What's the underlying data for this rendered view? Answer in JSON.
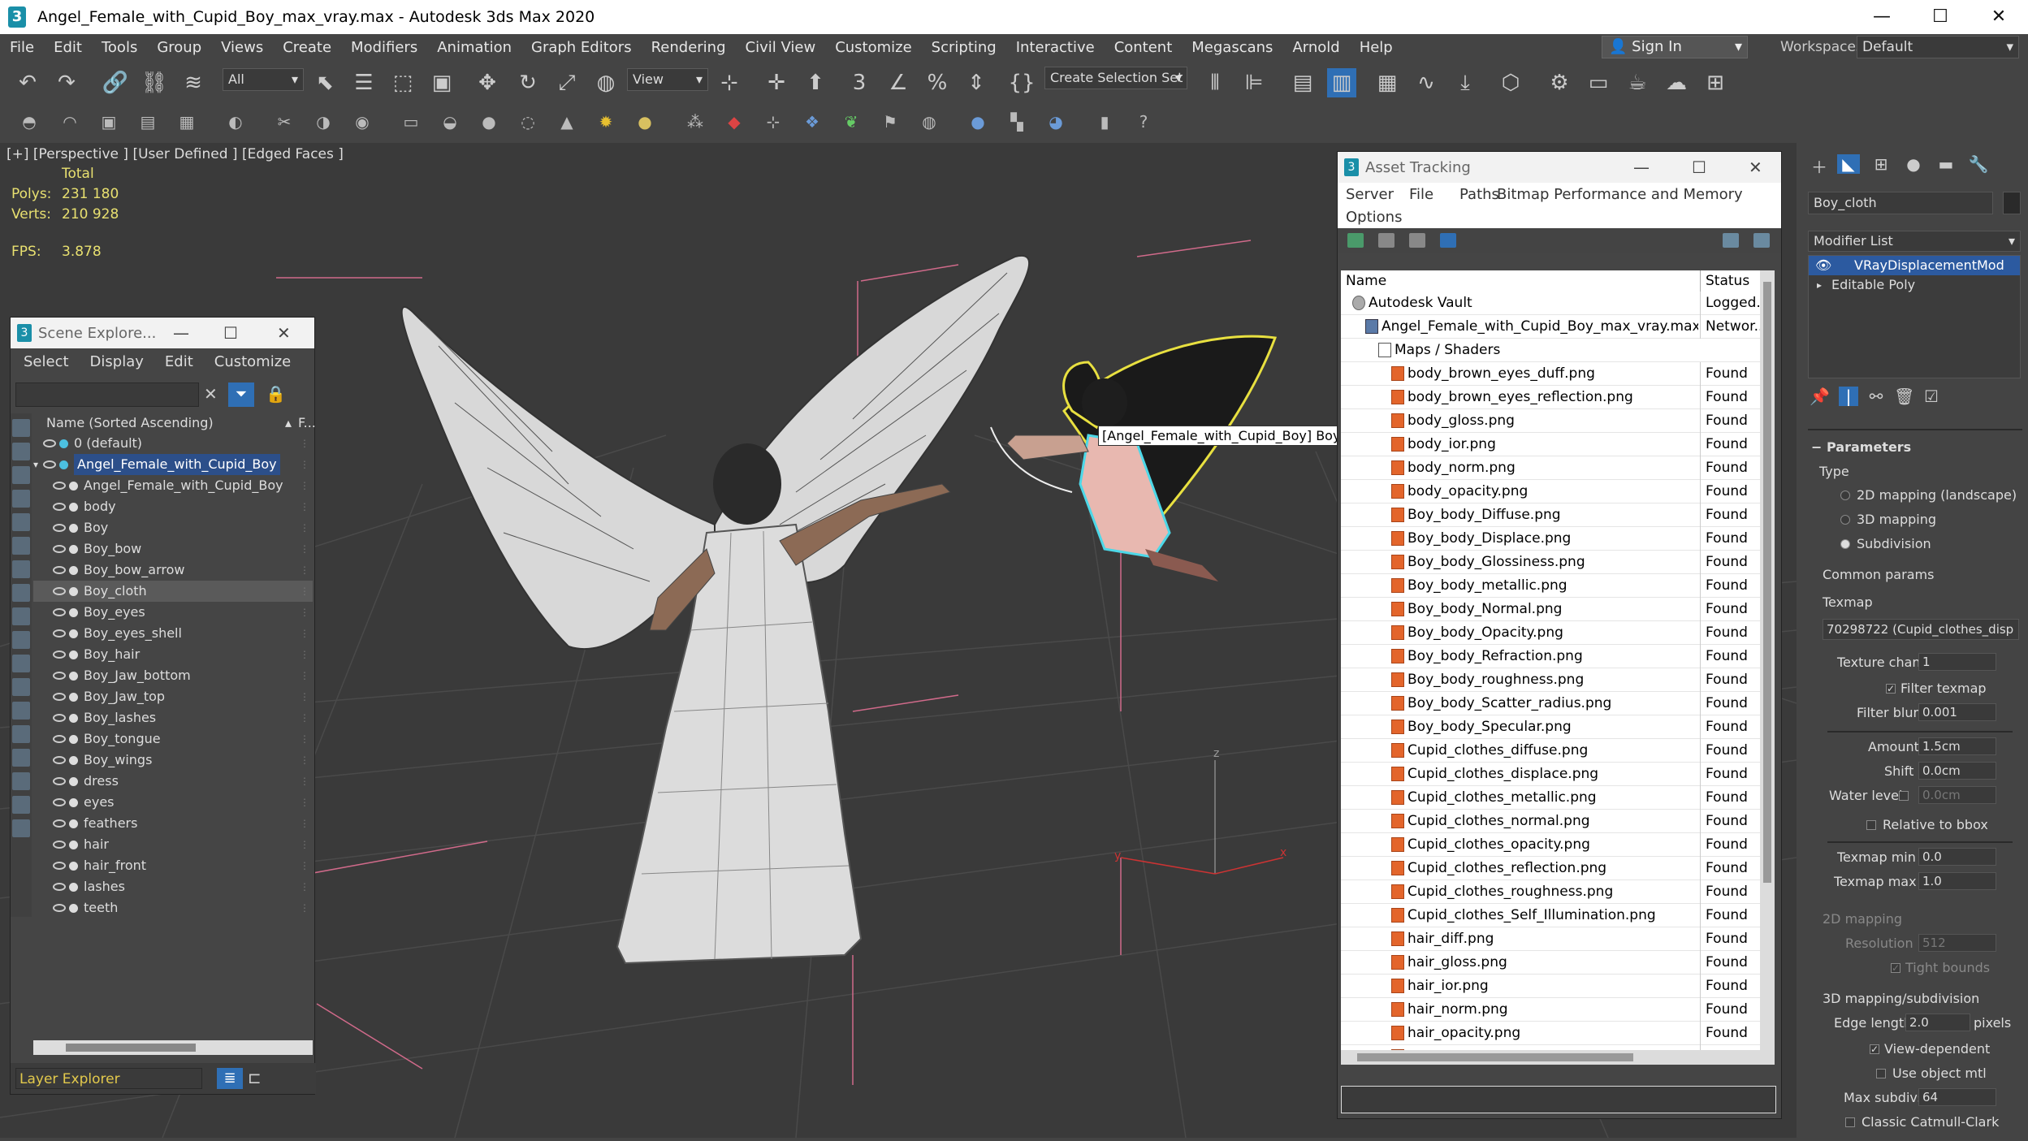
{
  "window": {
    "title": "Angel_Female_with_Cupid_Boy_max_vray.max - Autodesk 3ds Max 2020",
    "app_icon": "3",
    "minimize": "—",
    "maximize": "☐",
    "close": "✕"
  },
  "menu": [
    "File",
    "Edit",
    "Tools",
    "Group",
    "Views",
    "Create",
    "Modifiers",
    "Animation",
    "Graph Editors",
    "Rendering",
    "Civil View",
    "Customize",
    "Scripting",
    "Interactive",
    "Content",
    "Megascans",
    "Arnold",
    "Help"
  ],
  "signin": {
    "label": "Sign In"
  },
  "workspaces": {
    "label": "Workspaces:",
    "value": "Default"
  },
  "toolbar": {
    "filter_select": "All",
    "view_select": "View",
    "selection_set": "Create Selection Set"
  },
  "viewport": {
    "label": "[+] [Perspective ] [User Defined ] [Edged Faces ]",
    "stats_header": "Total",
    "polys_label": "Polys:",
    "polys_value": "231 180",
    "verts_label": "Verts:",
    "verts_value": "210 928",
    "fps_label": "FPS:",
    "fps_value": "3.878",
    "tooltip": "[Angel_Female_with_Cupid_Boy] Boy",
    "axis_y": "y",
    "axis_x": "x",
    "axis_z": "z"
  },
  "scene_explorer": {
    "title": "Scene Explore...",
    "menu": [
      "Select",
      "Display",
      "Edit",
      "Customize"
    ],
    "column_header": "Name (Sorted Ascending)",
    "column_header_f": "F...",
    "items": [
      {
        "name": "0 (default)",
        "indent": 0
      },
      {
        "name": "Angel_Female_with_Cupid_Boy",
        "indent": 0,
        "highlight": true
      },
      {
        "name": "Angel_Female_with_Cupid_Boy",
        "indent": 1
      },
      {
        "name": "body",
        "indent": 1
      },
      {
        "name": "Boy",
        "indent": 1
      },
      {
        "name": "Boy_bow",
        "indent": 1
      },
      {
        "name": "Boy_bow_arrow",
        "indent": 1
      },
      {
        "name": "Boy_cloth",
        "indent": 1,
        "selected": true
      },
      {
        "name": "Boy_eyes",
        "indent": 1
      },
      {
        "name": "Boy_eyes_shell",
        "indent": 1
      },
      {
        "name": "Boy_hair",
        "indent": 1
      },
      {
        "name": "Boy_Jaw_bottom",
        "indent": 1
      },
      {
        "name": "Boy_Jaw_top",
        "indent": 1
      },
      {
        "name": "Boy_lashes",
        "indent": 1
      },
      {
        "name": "Boy_tongue",
        "indent": 1
      },
      {
        "name": "Boy_wings",
        "indent": 1
      },
      {
        "name": "dress",
        "indent": 1
      },
      {
        "name": "eyes",
        "indent": 1
      },
      {
        "name": "feathers",
        "indent": 1
      },
      {
        "name": "hair",
        "indent": 1
      },
      {
        "name": "hair_front",
        "indent": 1
      },
      {
        "name": "lashes",
        "indent": 1
      },
      {
        "name": "teeth",
        "indent": 1
      }
    ],
    "footer_label": "Layer Explorer"
  },
  "asset_tracking": {
    "title": "Asset Tracking",
    "menu": {
      "server": "Server",
      "file": "File",
      "paths": "Paths",
      "bitmap": "Bitmap Performance and Memory",
      "options": "Options"
    },
    "col_name": "Name",
    "col_status": "Status",
    "rows": [
      {
        "name": "Autodesk Vault",
        "status": "Logged...",
        "indent": 0,
        "kind": "vault"
      },
      {
        "name": "Angel_Female_with_Cupid_Boy_max_vray.max",
        "status": "Networ...",
        "indent": 1,
        "kind": "max"
      },
      {
        "name": "Maps / Shaders",
        "status": "",
        "indent": 2,
        "kind": "folder"
      },
      {
        "name": "body_brown_eyes_duff.png",
        "status": "Found",
        "indent": 3,
        "kind": "file"
      },
      {
        "name": "body_brown_eyes_reflection.png",
        "status": "Found",
        "indent": 3,
        "kind": "file"
      },
      {
        "name": "body_gloss.png",
        "status": "Found",
        "indent": 3,
        "kind": "file"
      },
      {
        "name": "body_ior.png",
        "status": "Found",
        "indent": 3,
        "kind": "file"
      },
      {
        "name": "body_norm.png",
        "status": "Found",
        "indent": 3,
        "kind": "file"
      },
      {
        "name": "body_opacity.png",
        "status": "Found",
        "indent": 3,
        "kind": "file"
      },
      {
        "name": "Boy_body_Diffuse.png",
        "status": "Found",
        "indent": 3,
        "kind": "file"
      },
      {
        "name": "Boy_body_Displace.png",
        "status": "Found",
        "indent": 3,
        "kind": "file"
      },
      {
        "name": "Boy_body_Glossiness.png",
        "status": "Found",
        "indent": 3,
        "kind": "file"
      },
      {
        "name": "Boy_body_metallic.png",
        "status": "Found",
        "indent": 3,
        "kind": "file"
      },
      {
        "name": "Boy_body_Normal.png",
        "status": "Found",
        "indent": 3,
        "kind": "file"
      },
      {
        "name": "Boy_body_Opacity.png",
        "status": "Found",
        "indent": 3,
        "kind": "file"
      },
      {
        "name": "Boy_body_Refraction.png",
        "status": "Found",
        "indent": 3,
        "kind": "file"
      },
      {
        "name": "Boy_body_roughness.png",
        "status": "Found",
        "indent": 3,
        "kind": "file"
      },
      {
        "name": "Boy_body_Scatter_radius.png",
        "status": "Found",
        "indent": 3,
        "kind": "file"
      },
      {
        "name": "Boy_body_Specular.png",
        "status": "Found",
        "indent": 3,
        "kind": "file"
      },
      {
        "name": "Cupid_clothes_diffuse.png",
        "status": "Found",
        "indent": 3,
        "kind": "file"
      },
      {
        "name": "Cupid_clothes_displace.png",
        "status": "Found",
        "indent": 3,
        "kind": "file"
      },
      {
        "name": "Cupid_clothes_metallic.png",
        "status": "Found",
        "indent": 3,
        "kind": "file"
      },
      {
        "name": "Cupid_clothes_normal.png",
        "status": "Found",
        "indent": 3,
        "kind": "file"
      },
      {
        "name": "Cupid_clothes_opacity.png",
        "status": "Found",
        "indent": 3,
        "kind": "file"
      },
      {
        "name": "Cupid_clothes_reflection.png",
        "status": "Found",
        "indent": 3,
        "kind": "file"
      },
      {
        "name": "Cupid_clothes_roughness.png",
        "status": "Found",
        "indent": 3,
        "kind": "file"
      },
      {
        "name": "Cupid_clothes_Self_Illumination.png",
        "status": "Found",
        "indent": 3,
        "kind": "file"
      },
      {
        "name": "hair_diff.png",
        "status": "Found",
        "indent": 3,
        "kind": "file"
      },
      {
        "name": "hair_gloss.png",
        "status": "Found",
        "indent": 3,
        "kind": "file"
      },
      {
        "name": "hair_ior.png",
        "status": "Found",
        "indent": 3,
        "kind": "file"
      },
      {
        "name": "hair_norm.png",
        "status": "Found",
        "indent": 3,
        "kind": "file"
      },
      {
        "name": "hair_opacity.png",
        "status": "Found",
        "indent": 3,
        "kind": "file"
      },
      {
        "name": "hair_reflection.png",
        "status": "Found",
        "indent": 3,
        "kind": "file"
      }
    ]
  },
  "command_panel": {
    "object_name": "Boy_cloth",
    "modifier_list": "Modifier List",
    "stack": [
      "VRayDisplacementMod",
      "Editable Poly"
    ],
    "parameters": "Parameters",
    "type_label": "Type",
    "type_options": [
      "2D mapping (landscape)",
      "3D mapping",
      "Subdivision"
    ],
    "type_selected": 2,
    "common_params": "Common params",
    "texmap_label": "Texmap",
    "texmap_value": "70298722 (Cupid_clothes_disp",
    "texture_chan_label": "Texture chan",
    "texture_chan_value": "1",
    "filter_texmap": "Filter texmap",
    "filter_blur_label": "Filter blur",
    "filter_blur_value": "0.001",
    "amount_label": "Amount",
    "amount_value": "1.5cm",
    "shift_label": "Shift",
    "shift_value": "0.0cm",
    "water_level_label": "Water level",
    "water_level_value": "0.0cm",
    "relative_to_bbox": "Relative to bbox",
    "texmap_min_label": "Texmap min",
    "texmap_min_value": "0.0",
    "texmap_max_label": "Texmap max",
    "texmap_max_value": "1.0",
    "mapping_2d": "2D mapping",
    "resolution_label": "Resolution",
    "resolution_value": "512",
    "tight_bounds": "Tight bounds",
    "mapping_3d": "3D mapping/subdivision",
    "edge_length_label": "Edge length",
    "edge_length_value": "2.0",
    "pixels_label": "pixels",
    "view_dependent": "View-dependent",
    "use_object_mtl": "Use object mtl",
    "max_subdivs_label": "Max subdivs",
    "max_subdivs_value": "64",
    "classic_catmull": "Classic Catmull-Clark"
  },
  "colors": {
    "selection_blue": "#2c5aa0",
    "stats_yellow": "#e8e070",
    "layer_label_yellow": "#e2c94c",
    "file_icon_orange": "#e3652b"
  }
}
